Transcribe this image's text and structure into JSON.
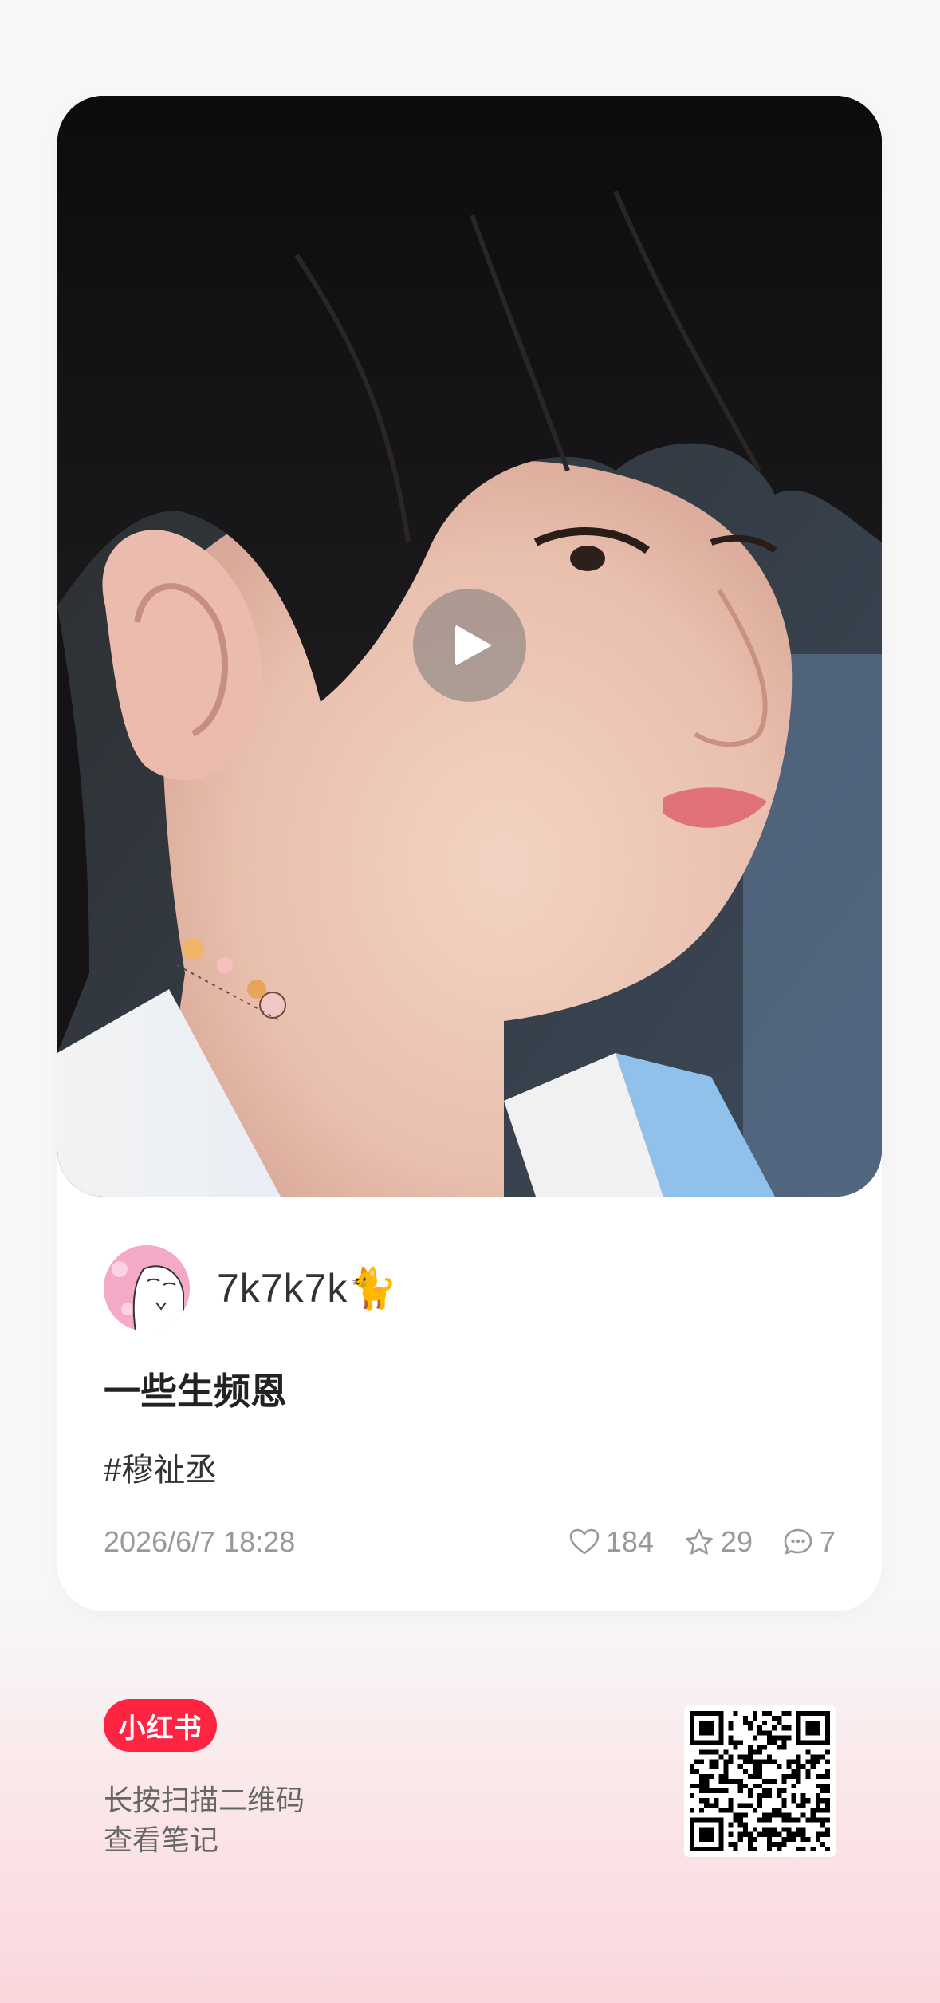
{
  "note": {
    "author_name": "7k7k7k🐈",
    "title": "一些生频恩",
    "tag": "#穆祉丞",
    "date": "2026/6/7 18:28",
    "stats": {
      "likes": "184",
      "collects": "29",
      "comments": "7"
    }
  },
  "cover": {
    "type": "video",
    "play_icon": "play-icon"
  },
  "footer": {
    "brand": "小红书",
    "line1": "长按扫描二维码",
    "line2": "查看笔记"
  },
  "colors": {
    "brand": "#ff2442",
    "muted": "#999999",
    "background": "#f7f7f7"
  }
}
